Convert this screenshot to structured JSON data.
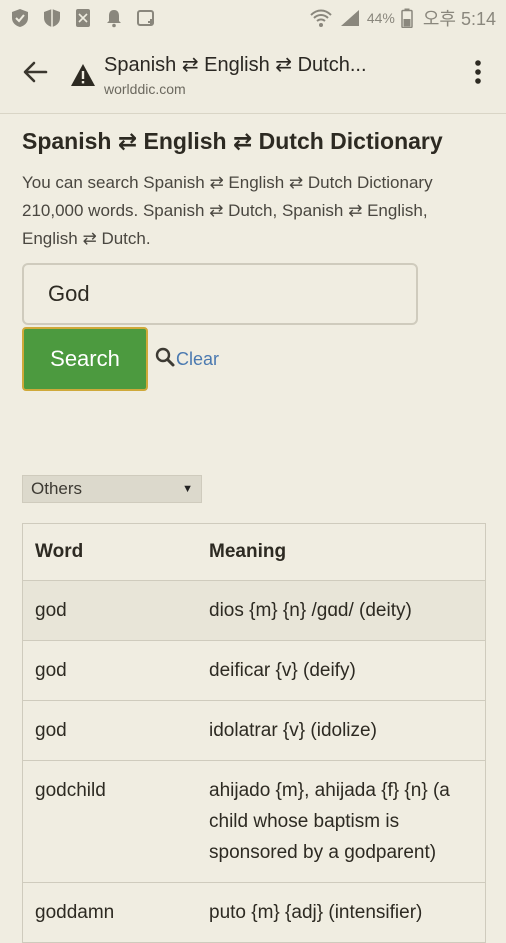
{
  "status_bar": {
    "battery_text": "44%",
    "time": "오후 5:14"
  },
  "toolbar": {
    "tab_title": "Spanish ⇄ English ⇄ Dutch...",
    "url": "worlddic.com"
  },
  "page": {
    "title": "Spanish ⇄ English ⇄ Dutch Dictionary",
    "description": "You can search Spanish ⇄ English ⇄ Dutch Dictionary 210,000 words. Spanish ⇄ Dutch, Spanish ⇄ English, English ⇄ Dutch."
  },
  "search": {
    "value": "God",
    "button_label": "Search",
    "clear_label": "Clear"
  },
  "filter": {
    "selected": "Others"
  },
  "table": {
    "headers": [
      "Word",
      "Meaning"
    ],
    "rows": [
      {
        "word": "god",
        "meaning": "dios {m} {n} /gɑd/ (deity)"
      },
      {
        "word": "god",
        "meaning": "deificar {v} (deify)"
      },
      {
        "word": "god",
        "meaning": "idolatrar {v} (idolize)"
      },
      {
        "word": "godchild",
        "meaning": "ahijado {m}, ahijada {f} {n} (a child whose baptism is sponsored by a godparent)"
      },
      {
        "word": "goddamn",
        "meaning": "puto {m} {adj} (intensifier)"
      }
    ]
  },
  "colors": {
    "background": "#f0ede1",
    "search_button": "#4c9a3f",
    "link": "#4a79b0"
  }
}
